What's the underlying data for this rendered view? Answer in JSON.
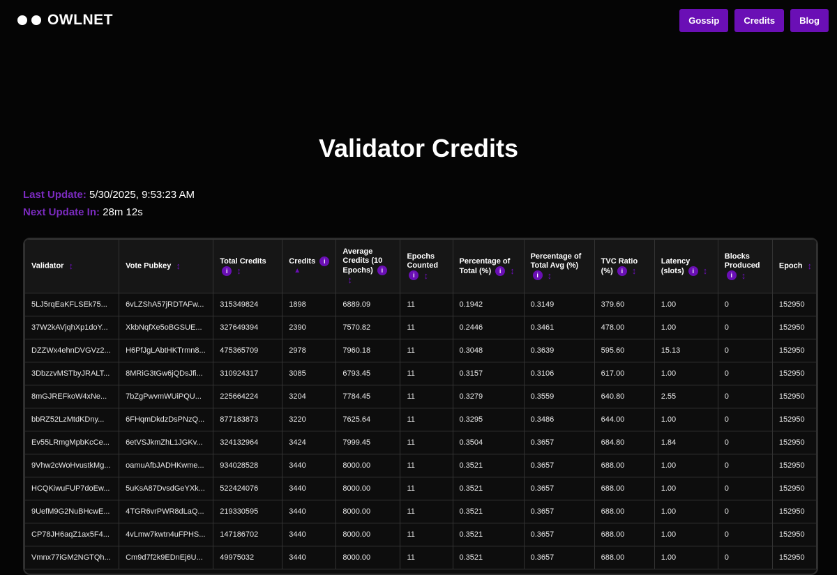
{
  "header": {
    "brand": "OWLNET",
    "nav": [
      "Gossip",
      "Credits",
      "Blog"
    ]
  },
  "page": {
    "title": "Validator Credits",
    "last_update_label": "Last Update:",
    "last_update_value": "5/30/2025, 9:53:23 AM",
    "next_update_label": "Next Update In:",
    "next_update_value": "28m 12s"
  },
  "icons": {
    "info": "i",
    "sort": "↕",
    "sort_active": "▲"
  },
  "colors": {
    "accent": "#6a0fb5",
    "background": "#050505"
  },
  "table": {
    "columns": [
      {
        "label": "Validator",
        "info": false,
        "sort": "none"
      },
      {
        "label": "Vote Pubkey",
        "info": false,
        "sort": "none"
      },
      {
        "label": "Total Credits",
        "info": true,
        "sort": "none"
      },
      {
        "label": "Credits",
        "info": true,
        "sort": "asc"
      },
      {
        "label": "Average Credits (10 Epochs)",
        "info": true,
        "sort": "none"
      },
      {
        "label": "Epochs Counted",
        "info": true,
        "sort": "none"
      },
      {
        "label": "Percentage of Total (%)",
        "info": true,
        "sort": "none"
      },
      {
        "label": "Percentage of Total Avg (%)",
        "info": true,
        "sort": "none"
      },
      {
        "label": "TVC Ratio (%)",
        "info": true,
        "sort": "none"
      },
      {
        "label": "Latency (slots)",
        "info": true,
        "sort": "none"
      },
      {
        "label": "Blocks Produced",
        "info": true,
        "sort": "none"
      },
      {
        "label": "Epoch",
        "info": false,
        "sort": "none"
      }
    ],
    "rows": [
      [
        "5LJ5rqEaKFLSEk75...",
        "6vLZShA57jRDTAFw...",
        "315349824",
        "1898",
        "6889.09",
        "11",
        "0.1942",
        "0.3149",
        "379.60",
        "1.00",
        "0",
        "152950"
      ],
      [
        "37W2kAVjqhXp1doY...",
        "XkbNqfXe5oBGSUE...",
        "327649394",
        "2390",
        "7570.82",
        "11",
        "0.2446",
        "0.3461",
        "478.00",
        "1.00",
        "0",
        "152950"
      ],
      [
        "DZZWx4ehnDVGVz2...",
        "H6PfJgLAbtHKTrmn8...",
        "475365709",
        "2978",
        "7960.18",
        "11",
        "0.3048",
        "0.3639",
        "595.60",
        "15.13",
        "0",
        "152950"
      ],
      [
        "3DbzzvMSTbyJRALT...",
        "8MRiG3tGw6jQDsJfi...",
        "310924317",
        "3085",
        "6793.45",
        "11",
        "0.3157",
        "0.3106",
        "617.00",
        "1.00",
        "0",
        "152950"
      ],
      [
        "8mGJREFkoW4xNe...",
        "7bZgPwvmWUiPQU...",
        "225664224",
        "3204",
        "7784.45",
        "11",
        "0.3279",
        "0.3559",
        "640.80",
        "2.55",
        "0",
        "152950"
      ],
      [
        "bbRZ52LzMtdKDny...",
        "6FHqmDkdzDsPNzQ...",
        "877183873",
        "3220",
        "7625.64",
        "11",
        "0.3295",
        "0.3486",
        "644.00",
        "1.00",
        "0",
        "152950"
      ],
      [
        "Ev55LRmgMpbKcCe...",
        "6etVSJkmZhL1JGKv...",
        "324132964",
        "3424",
        "7999.45",
        "11",
        "0.3504",
        "0.3657",
        "684.80",
        "1.84",
        "0",
        "152950"
      ],
      [
        "9Vhw2cWoHvustkMg...",
        "oamuAfbJADHKwme...",
        "934028528",
        "3440",
        "8000.00",
        "11",
        "0.3521",
        "0.3657",
        "688.00",
        "1.00",
        "0",
        "152950"
      ],
      [
        "HCQKiwuFUP7doEw...",
        "5uKsA87DvsdGeYXk...",
        "522424076",
        "3440",
        "8000.00",
        "11",
        "0.3521",
        "0.3657",
        "688.00",
        "1.00",
        "0",
        "152950"
      ],
      [
        "9UefM9G2NuBHcwE...",
        "4TGR6vrPWR8dLaQ...",
        "219330595",
        "3440",
        "8000.00",
        "11",
        "0.3521",
        "0.3657",
        "688.00",
        "1.00",
        "0",
        "152950"
      ],
      [
        "CP78JH6aqZ1ax5F4...",
        "4vLmw7kwtn4uFPHS...",
        "147186702",
        "3440",
        "8000.00",
        "11",
        "0.3521",
        "0.3657",
        "688.00",
        "1.00",
        "0",
        "152950"
      ],
      [
        "Vmnx77iGM2NGTQh...",
        "Cm9d7f2k9EDnEj6U...",
        "49975032",
        "3440",
        "8000.00",
        "11",
        "0.3521",
        "0.3657",
        "688.00",
        "1.00",
        "0",
        "152950"
      ]
    ]
  }
}
